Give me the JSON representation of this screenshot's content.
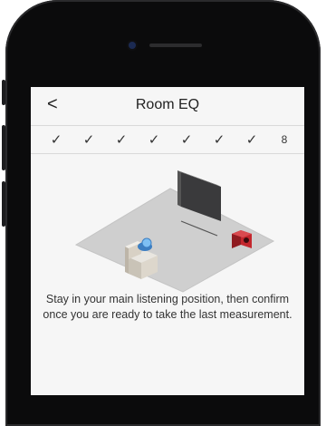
{
  "nav": {
    "back_label": "<",
    "title": "Room EQ"
  },
  "steps": {
    "check_glyph": "✓",
    "items": [
      "✓",
      "✓",
      "✓",
      "✓",
      "✓",
      "✓",
      "✓",
      "8"
    ]
  },
  "illustration": {
    "icons": [
      "floor",
      "tv-icon",
      "speaker-icon",
      "armchair-icon",
      "listener-icon"
    ]
  },
  "instruction": "Stay in your main listening position, then confirm once you are ready to take the last measurement.",
  "colors": {
    "speaker": "#b8262c",
    "listener": "#5aa7e8",
    "floor": "#cfcfcf"
  }
}
